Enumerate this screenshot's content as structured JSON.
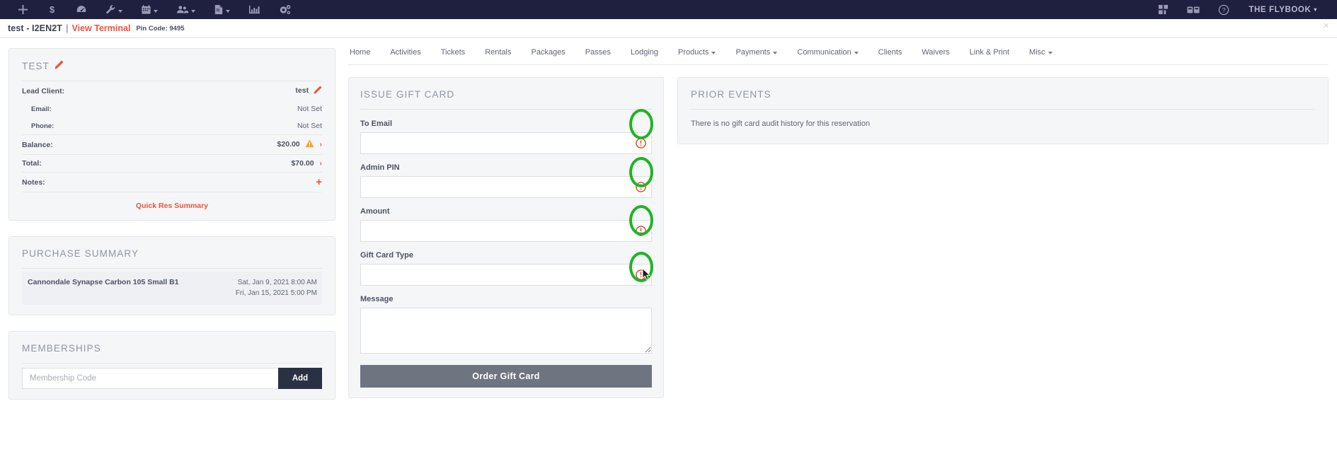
{
  "toolbar": {
    "items": [
      {
        "name": "add-icon",
        "glyph": "plus",
        "caret": false
      },
      {
        "name": "dollar-icon",
        "glyph": "dollar",
        "caret": false
      },
      {
        "name": "dashboard-icon",
        "glyph": "gauge",
        "caret": false
      },
      {
        "name": "wrench-icon",
        "glyph": "wrench",
        "caret": true
      },
      {
        "name": "calendar-icon",
        "glyph": "calendar",
        "caret": true
      },
      {
        "name": "users-icon",
        "glyph": "users",
        "caret": true
      },
      {
        "name": "document-icon",
        "glyph": "document",
        "caret": true
      },
      {
        "name": "chart-icon",
        "glyph": "chart",
        "caret": false
      },
      {
        "name": "settings-icon",
        "glyph": "gears",
        "caret": false
      }
    ],
    "right_items": [
      {
        "name": "grid-icon",
        "glyph": "grid"
      },
      {
        "name": "cards-icon",
        "glyph": "cards"
      },
      {
        "name": "help-icon",
        "glyph": "help"
      }
    ],
    "brand_label": "THE FLYBOOK",
    "brand_caret": "▾"
  },
  "page_header": {
    "title": "test - I2EN2T",
    "separator": "|",
    "terminal_link": "View Terminal",
    "pin_code": "Pin Code: 9495",
    "close_label": "×"
  },
  "reservation_panel": {
    "title": "TEST",
    "rows": [
      {
        "label": "Lead Client:",
        "value": "test",
        "has_pencil": true,
        "sub": false,
        "bold_value": true
      },
      {
        "label": "Email:",
        "value": "Not Set",
        "has_pencil": false,
        "sub": true,
        "bold_value": false
      },
      {
        "label": "Phone:",
        "value": "Not Set",
        "has_pencil": false,
        "sub": true,
        "bold_value": false
      },
      {
        "label": "Balance:",
        "value": "$20.00",
        "has_pencil": false,
        "sub": false,
        "bold_value": true
      },
      {
        "label": "Total:",
        "value": "$70.00",
        "has_pencil": false,
        "sub": false,
        "bold_value": true
      },
      {
        "label": "Notes:",
        "value": "+",
        "has_pencil": false,
        "sub": false,
        "bold_value": false
      }
    ],
    "quick_res_summary": "Quick Res Summary"
  },
  "purchase_summary": {
    "title": "PURCHASE SUMMARY",
    "items": [
      {
        "name": "Cannondale Synapse Carbon 105 Small B1",
        "start": "Sat, Jan 9, 2021 8:00 AM",
        "end": "Fri, Jan 15, 2021 5:00 PM"
      }
    ]
  },
  "memberships": {
    "title": "MEMBERSHIPS",
    "input_placeholder": "Membership Code",
    "input_value": "",
    "add_label": "Add"
  },
  "nav_tabs": [
    {
      "label": "Home",
      "caret": false
    },
    {
      "label": "Activities",
      "caret": false
    },
    {
      "label": "Tickets",
      "caret": false
    },
    {
      "label": "Rentals",
      "caret": false
    },
    {
      "label": "Packages",
      "caret": false
    },
    {
      "label": "Passes",
      "caret": false
    },
    {
      "label": "Lodging",
      "caret": false
    },
    {
      "label": "Products",
      "caret": true
    },
    {
      "label": "Payments",
      "caret": true
    },
    {
      "label": "Communication",
      "caret": true
    },
    {
      "label": "Clients",
      "caret": false
    },
    {
      "label": "Waivers",
      "caret": false
    },
    {
      "label": "Link & Print",
      "caret": false
    },
    {
      "label": "Misc",
      "caret": true
    }
  ],
  "gift_card_form": {
    "title": "ISSUE GIFT CARD",
    "fields": {
      "to_email": {
        "label": "To Email",
        "value": "",
        "placeholder": ""
      },
      "admin_pin": {
        "label": "Admin PIN",
        "value": "",
        "placeholder": ""
      },
      "amount": {
        "label": "Amount",
        "value": "",
        "placeholder": ""
      },
      "gift_card_type": {
        "label": "Gift Card Type",
        "value": "",
        "placeholder": ""
      },
      "message": {
        "label": "Message",
        "value": "",
        "placeholder": ""
      }
    },
    "submit_label": "Order Gift Card"
  },
  "prior_events": {
    "title": "PRIOR EVENTS",
    "empty_text": "There is no gift card audit history for this reservation"
  },
  "colors": {
    "topbar_bg": "#1f2040",
    "accent_orange": "#f0533a",
    "annotation_green": "#1db524",
    "required_red": "#e04a32",
    "warning_amber": "#f5a623",
    "panel_bg": "#f5f6f7",
    "button_dark": "#2b3145",
    "button_gray": "#6f7481"
  }
}
